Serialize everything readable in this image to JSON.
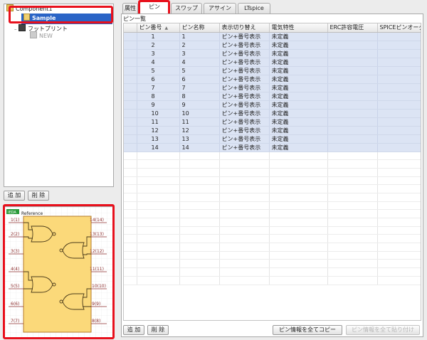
{
  "tree": {
    "root_label": "Component1",
    "sample_label": "Sample",
    "footprint_label": "フットプリント",
    "new_label": "NEW"
  },
  "left_buttons": {
    "add": "追 加",
    "delete": "削 除"
  },
  "symbol": {
    "badge": "IEDA",
    "reference": "Reference",
    "left_pins": [
      "1(1)",
      "2(2)",
      "3(3)",
      "4(4)",
      "5(5)",
      "6(6)",
      "7(7)"
    ],
    "right_pins": [
      "14(14)",
      "13(13)",
      "12(12)",
      "11(11)",
      "10(10)",
      "9(9)",
      "8(8)"
    ]
  },
  "tabs": [
    "属性",
    "ピン",
    "スワップ",
    "アサイン",
    "LTspice"
  ],
  "active_tab": "ピン",
  "pin_list": {
    "title": "ピン一覧",
    "columns": [
      "ピン番号",
      "ピン名称",
      "表示切り替え",
      "電気特性",
      "ERC許容電圧",
      "SPICEピンオーダー"
    ],
    "rows": [
      [
        "1",
        "1",
        "ピン+番号表示",
        "未定義"
      ],
      [
        "2",
        "2",
        "ピン+番号表示",
        "未定義"
      ],
      [
        "3",
        "3",
        "ピン+番号表示",
        "未定義"
      ],
      [
        "4",
        "4",
        "ピン+番号表示",
        "未定義"
      ],
      [
        "5",
        "5",
        "ピン+番号表示",
        "未定義"
      ],
      [
        "6",
        "6",
        "ピン+番号表示",
        "未定義"
      ],
      [
        "7",
        "7",
        "ピン+番号表示",
        "未定義"
      ],
      [
        "8",
        "8",
        "ピン+番号表示",
        "未定義"
      ],
      [
        "9",
        "9",
        "ピン+番号表示",
        "未定義"
      ],
      [
        "10",
        "10",
        "ピン+番号表示",
        "未定義"
      ],
      [
        "11",
        "11",
        "ピン+番号表示",
        "未定義"
      ],
      [
        "12",
        "12",
        "ピン+番号表示",
        "未定義"
      ],
      [
        "13",
        "13",
        "ピン+番号表示",
        "未定義"
      ],
      [
        "14",
        "14",
        "ピン+番号表示",
        "未定義"
      ]
    ]
  },
  "bottom_buttons": {
    "add": "追 加",
    "delete": "削 除",
    "copy_all": "ピン情報を全てコピー",
    "paste_all": "ピン情報を全て貼り付け"
  }
}
